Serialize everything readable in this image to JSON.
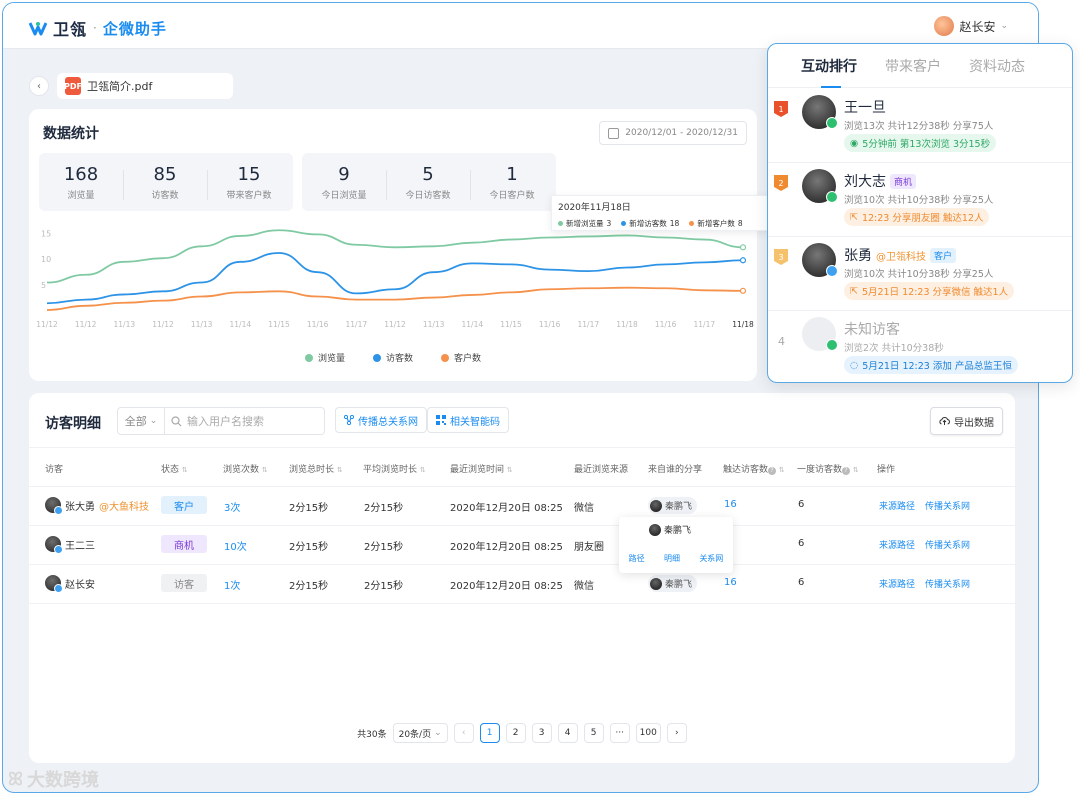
{
  "app": {
    "brand": "卫瓴",
    "dot": "·",
    "product": "企微助手",
    "user_name": "赵长安"
  },
  "crumb": {
    "file_name": "卫瓴简介.pdf",
    "file_badge": "PDF"
  },
  "stats": {
    "title": "数据统计",
    "date_range": "2020/12/01 - 2020/12/31",
    "kpi_total": [
      {
        "value": "168",
        "label": "浏览量"
      },
      {
        "value": "85",
        "label": "访客数"
      },
      {
        "value": "15",
        "label": "带来客户数"
      }
    ],
    "kpi_today": [
      {
        "value": "9",
        "label": "今日浏览量"
      },
      {
        "value": "5",
        "label": "今日访客数"
      },
      {
        "value": "1",
        "label": "今日客户数"
      }
    ],
    "tooltip": {
      "title": "2020年11月18日",
      "items": [
        {
          "label": "新增浏览量",
          "value": "3"
        },
        {
          "label": "新增访客数",
          "value": "18"
        },
        {
          "label": "新增客户数",
          "value": "8"
        }
      ]
    }
  },
  "chart_data": {
    "type": "line",
    "x": [
      "11/12",
      "11/12",
      "11/13",
      "11/12",
      "11/13",
      "11/14",
      "11/15",
      "11/16",
      "11/17",
      "11/12",
      "11/13",
      "11/14",
      "11/15",
      "11/16",
      "11/17",
      "11/18",
      "11/16",
      "11/17",
      "11/18"
    ],
    "y_ticks": [
      "5",
      "10",
      "15"
    ],
    "ylim": [
      0,
      17
    ],
    "series": [
      {
        "name": "浏览量",
        "color": "#7fcaa2",
        "values": [
          5.5,
          7,
          9.5,
          10.2,
          12.5,
          14.5,
          15.6,
          14.8,
          12.8,
          12.3,
          12.5,
          13.2,
          13.8,
          14.2,
          14.4,
          14.6,
          14.2,
          13.8,
          12.3
        ]
      },
      {
        "name": "访客数",
        "color": "#2d93e6",
        "values": [
          1.5,
          2.2,
          3.2,
          3.8,
          5.5,
          9.5,
          11.2,
          7.5,
          3.4,
          4.2,
          7.5,
          9.2,
          9.0,
          8.0,
          7.7,
          8.4,
          9.0,
          9.4,
          9.8
        ]
      },
      {
        "name": "客户数",
        "color": "#f5914a",
        "values": [
          0.2,
          1.0,
          1.6,
          2.0,
          2.8,
          3.6,
          3.8,
          2.8,
          2.2,
          2.2,
          2.6,
          3.1,
          3.6,
          4.2,
          4.4,
          4.5,
          4.4,
          4.0,
          3.9
        ]
      }
    ]
  },
  "table": {
    "title": "访客明细",
    "filter": "全部",
    "search_placeholder": "输入用户名搜索",
    "btn_relation": "传播总关系网",
    "btn_code": "相关智能码",
    "btn_export": "导出数据",
    "headers": {
      "visitor": "访客",
      "status": "状态",
      "views": "浏览次数",
      "total_time": "浏览总时长",
      "avg_time": "平均浏览时长",
      "last_time": "最近浏览时间",
      "source": "最近浏览来源",
      "sharer": "来自谁的分享",
      "reach": "触达访客数",
      "first_deg": "一度访客数",
      "ops": "操作"
    },
    "rows": [
      {
        "name": "张大勇",
        "company": "@大鱼科技",
        "status": "客户",
        "views": "3次",
        "total": "2分15秒",
        "avg": "2分15秒",
        "last": "2020年12月20日 08:25",
        "source": "微信",
        "sharer": "秦鹏飞",
        "reach": "16",
        "first": "6",
        "op1": "来源路径",
        "op2": "传播关系网"
      },
      {
        "name": "王二三",
        "company": "",
        "status": "商机",
        "views": "10次",
        "total": "2分15秒",
        "avg": "2分15秒",
        "last": "2020年12月20日 08:25",
        "source": "朋友圈",
        "sharer": "",
        "reach": "",
        "first": "6",
        "op1": "来源路径",
        "op2": "传播关系网"
      },
      {
        "name": "赵长安",
        "company": "",
        "status": "访客",
        "views": "1次",
        "total": "2分15秒",
        "avg": "2分15秒",
        "last": "2020年12月20日 08:25",
        "source": "微信",
        "sharer": "秦鹏飞",
        "reach": "16",
        "first": "6",
        "op1": "来源路径",
        "op2": "传播关系网"
      }
    ],
    "popover": {
      "name": "秦鹏飞",
      "links": [
        "路径",
        "明细",
        "关系网"
      ]
    },
    "pager": {
      "total": "共30条",
      "size": "20条/页",
      "pages": [
        "1",
        "2",
        "3",
        "4",
        "5",
        "···",
        "100"
      ],
      "prev": "‹",
      "next": "›"
    }
  },
  "ranking": {
    "tabs": [
      "互动排行",
      "带来客户",
      "资料动态"
    ],
    "items": [
      {
        "rank": "1",
        "name": "王一旦",
        "company": "",
        "tag": "",
        "meta": "浏览13次   共计12分38秒   分享75人",
        "note": "5分钟前 第13次浏览 3分15秒"
      },
      {
        "rank": "2",
        "name": "刘大志",
        "company": "",
        "tag": "商机",
        "meta": "浏览10次   共计10分38秒   分享25人",
        "note": "12:23 分享朋友圈 触达12人"
      },
      {
        "rank": "3",
        "name": "张勇",
        "company": "@卫瓴科技",
        "tag": "客户",
        "meta": "浏览10次   共计10分38秒   分享25人",
        "note": "5月21日 12:23 分享微信 触达1人"
      },
      {
        "rank": "4",
        "name": "未知访客",
        "company": "",
        "tag": "",
        "meta": "浏览2次   共计10分38秒",
        "note": "5月21日 12:23 添加 产品总监王恒"
      }
    ]
  },
  "watermark": "大数跨境"
}
